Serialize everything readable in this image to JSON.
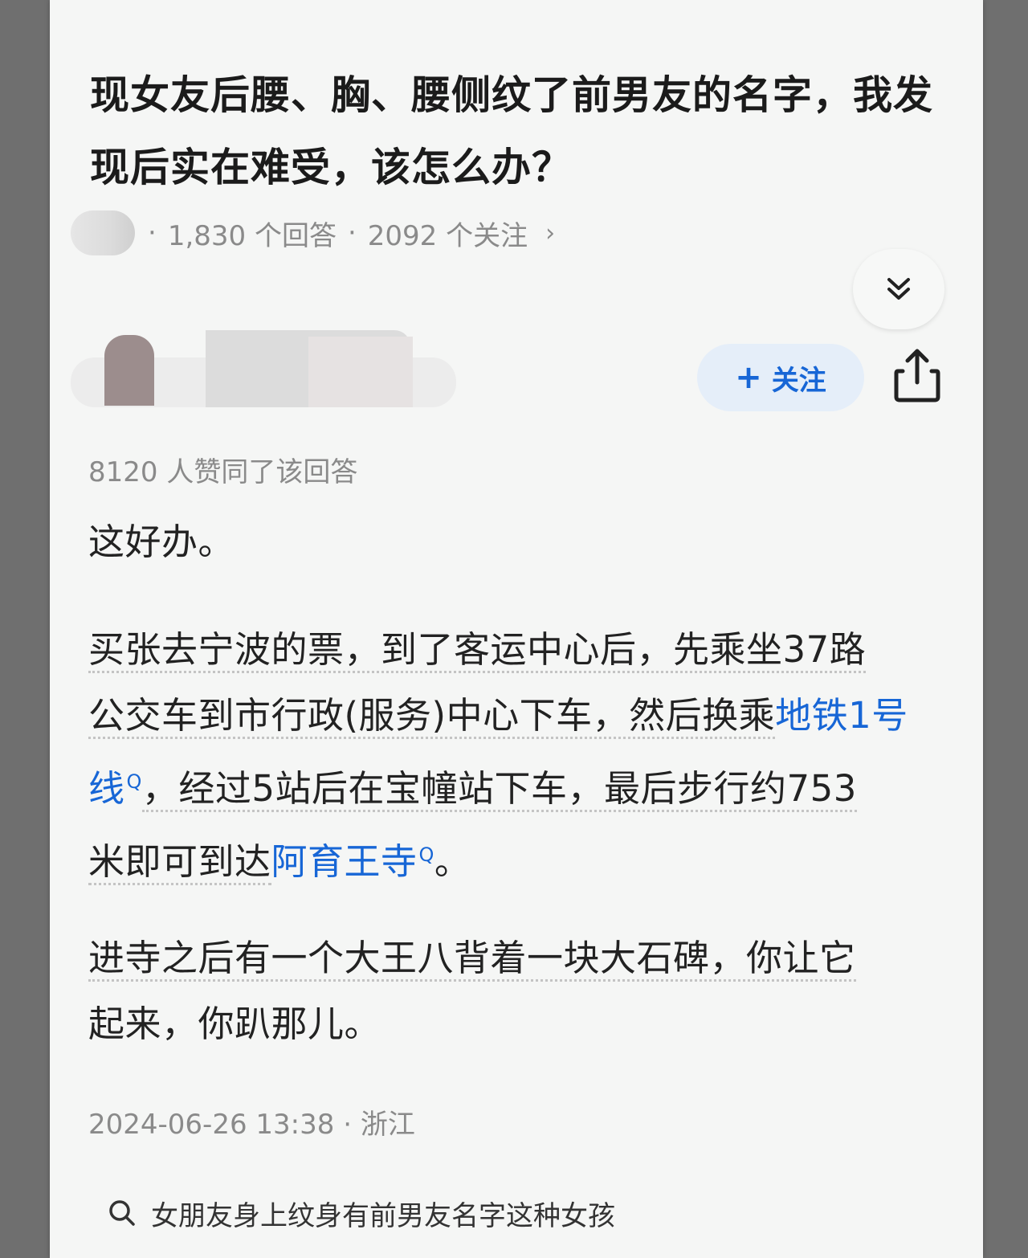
{
  "question": {
    "title": "现女友后腰、胸、腰侧纹了前男友的名字，我发现后实在难受，该怎么办？",
    "answer_count": "1,830 个回答",
    "follow_count": "2092 个关注"
  },
  "answer": {
    "follow_label": "关注",
    "likes": "8120 人赞同了该回答",
    "para1": "这好办。",
    "para2": {
      "line1": "买张去宁波的票，到了客运中心后，先乘坐37路",
      "line2_pre": "公交车到市行政(服务)中心下车，然后换乘",
      "link1": "地铁1号线",
      "line3_post": "，经过5站后在宝幢站下车，最后步行约753",
      "line4_pre": "米即可到达",
      "link2": "阿育王寺",
      "line4_post": "。"
    },
    "para3": {
      "line1": "进寺之后有一个大王八背着一块大石碑，你让它",
      "line2": "起来，你趴那儿。"
    },
    "timestamp": "2024-06-26 13:38",
    "location": "浙江"
  },
  "related_search": "女朋友身上纹身有前男友名字这种女孩",
  "colors": {
    "accent": "#1766d6",
    "follow_bg": "#e5eef9",
    "text": "#222222",
    "muted": "#8a8a8a"
  },
  "icons": [
    "chevron-right-icon",
    "double-chevron-down-icon",
    "plus-icon",
    "share-icon",
    "search-icon",
    "link-search-icon"
  ]
}
